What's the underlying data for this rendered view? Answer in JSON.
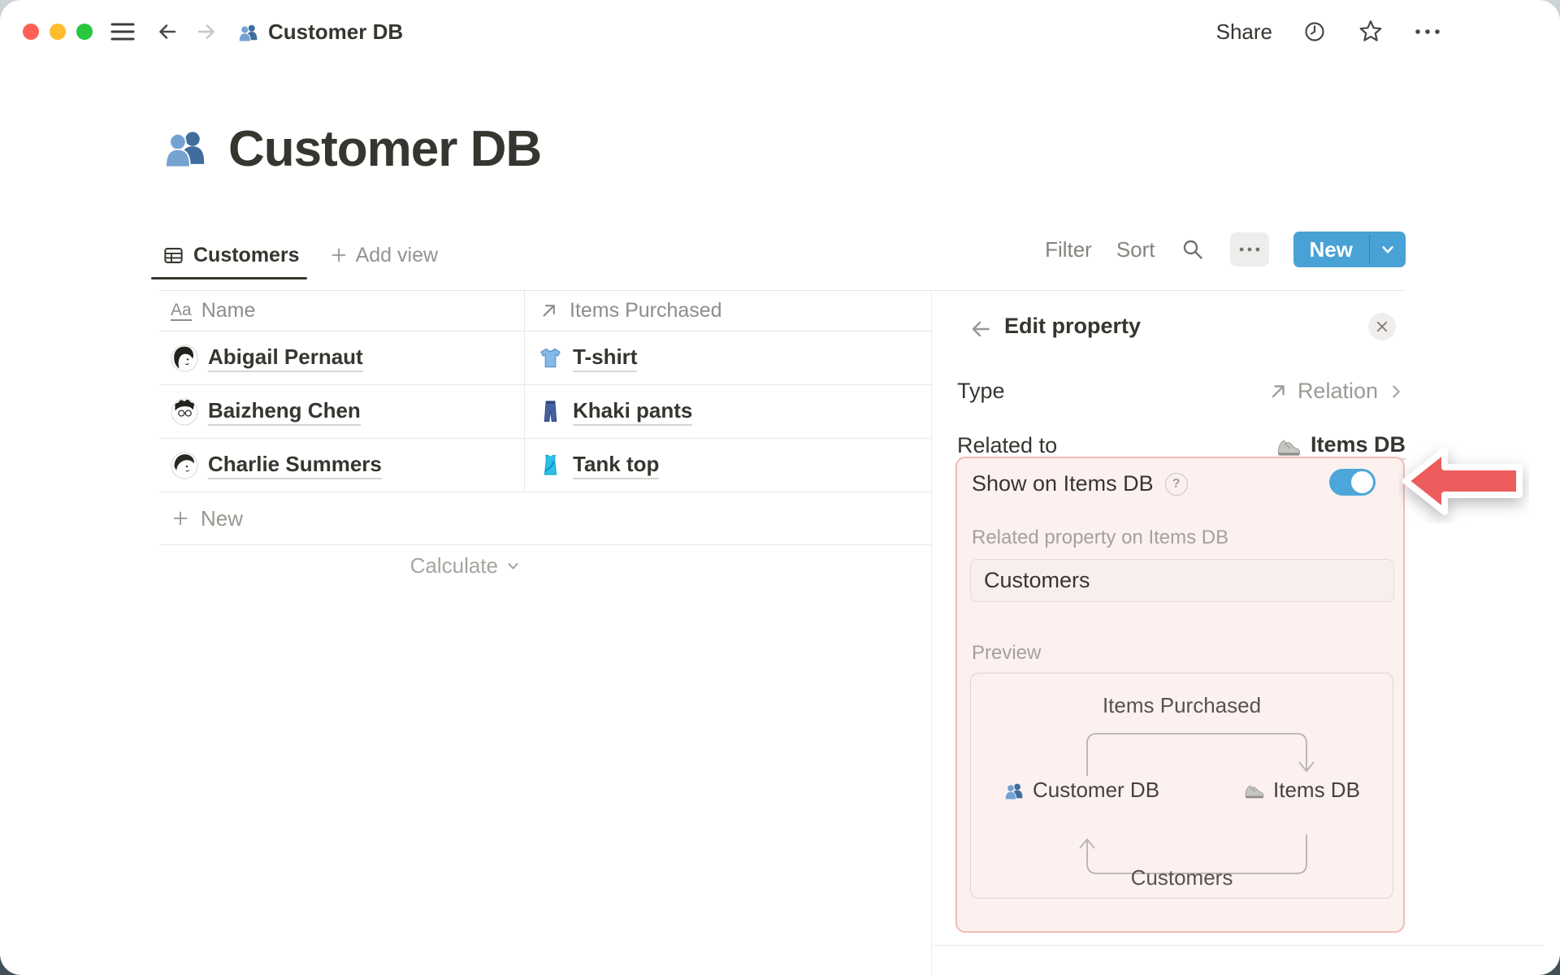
{
  "topbar": {
    "breadcrumb_title": "Customer DB",
    "share_label": "Share"
  },
  "page": {
    "title": "Customer DB"
  },
  "view_bar": {
    "active_view": "Customers",
    "add_view_label": "Add view",
    "filter_label": "Filter",
    "sort_label": "Sort",
    "new_label": "New"
  },
  "table": {
    "columns": [
      {
        "label": "Name",
        "type": "text"
      },
      {
        "label": "Items Purchased",
        "type": "relation"
      }
    ],
    "rows": [
      {
        "name": "Abigail Pernaut",
        "item": "T-shirt"
      },
      {
        "name": "Baizheng Chen",
        "item": "Khaki pants"
      },
      {
        "name": "Charlie Summers",
        "item": "Tank top"
      }
    ],
    "new_row_label": "New",
    "calculate_label": "Calculate"
  },
  "panel": {
    "title": "Edit property",
    "type_label": "Type",
    "type_value": "Relation",
    "related_label": "Related to",
    "related_value": "Items DB",
    "highlight": {
      "toggle_label": "Show on Items DB",
      "toggle_state": "on",
      "related_property_label": "Related property on Items DB",
      "input_value": "Customers",
      "preview_label": "Preview",
      "preview": {
        "top_relation": "Items Purchased",
        "left_db": "Customer DB",
        "right_db": "Items DB",
        "bottom_relation": "Customers"
      }
    }
  },
  "icons": {
    "text_property_glyph": "Aa",
    "help_glyph": "?",
    "people_icon": "two blue person silhouettes",
    "sneaker_icon": "gray running shoe",
    "tshirt_icon": "light blue t-shirt",
    "jeans_icon": "dark blue pants",
    "tanktop_icon": "cyan tank top",
    "annotation_arrow": "red arrow pointing left at toggle"
  },
  "colors": {
    "accent_blue": "#48a2d5",
    "toggle_blue": "#4ca6d9",
    "highlight_bg": "#fcf1ef",
    "highlight_border": "#f2bab6",
    "arrow_red": "#ed5c5c",
    "text_dark": "#37352f",
    "text_gray": "#8f8d89"
  }
}
